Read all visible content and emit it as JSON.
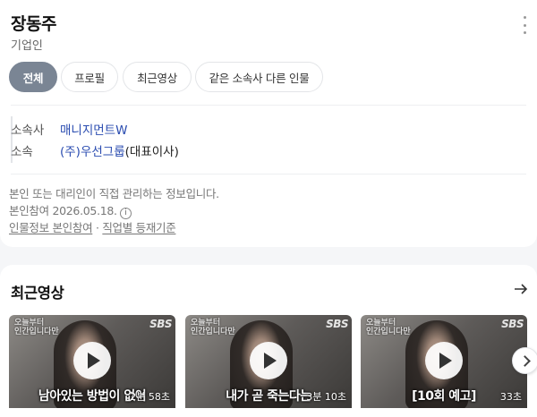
{
  "profile": {
    "name": "장동주",
    "job": "기업인"
  },
  "tabs": [
    {
      "label": "전체",
      "active": true
    },
    {
      "label": "프로필",
      "active": false
    },
    {
      "label": "최근영상",
      "active": false
    },
    {
      "label": "같은 소속사 다른 인물",
      "active": false
    }
  ],
  "info": {
    "agency_key": "소속사",
    "agency_value": "매니지먼트W",
    "belong_key": "소속",
    "belong_value_link": "(주)우선그룹",
    "belong_value_suffix": "(대표이사)"
  },
  "notes": {
    "managed_text": "본인 또는 대리인이 직접 관리하는 정보입니다.",
    "participation": "본인참여 2026.05.18.",
    "info_icon_glyph": "i",
    "link_participation": "인물정보 본인참여",
    "separator": "·",
    "link_criteria": "직업별 등재기준"
  },
  "recent": {
    "title": "최근영상",
    "videos": [
      {
        "program": "오늘부터\n인간입니다만",
        "caption": "남아있는 방법이 없어",
        "duration": "2분 58초"
      },
      {
        "program": "오늘부터\n인간입니다만",
        "caption": "내가 곧 죽는다는",
        "duration": "3분 10초"
      },
      {
        "program": "오늘부터\n인간입니다만",
        "caption": "[10회 예고]",
        "duration": "33초"
      }
    ],
    "channel": "SBS"
  },
  "colors": {
    "active_tab": "#7a8594",
    "link": "#2a4cb0"
  },
  "icons": [
    "more-vertical-icon",
    "info-icon",
    "arrow-right-icon",
    "play-icon",
    "chevron-right-icon"
  ]
}
